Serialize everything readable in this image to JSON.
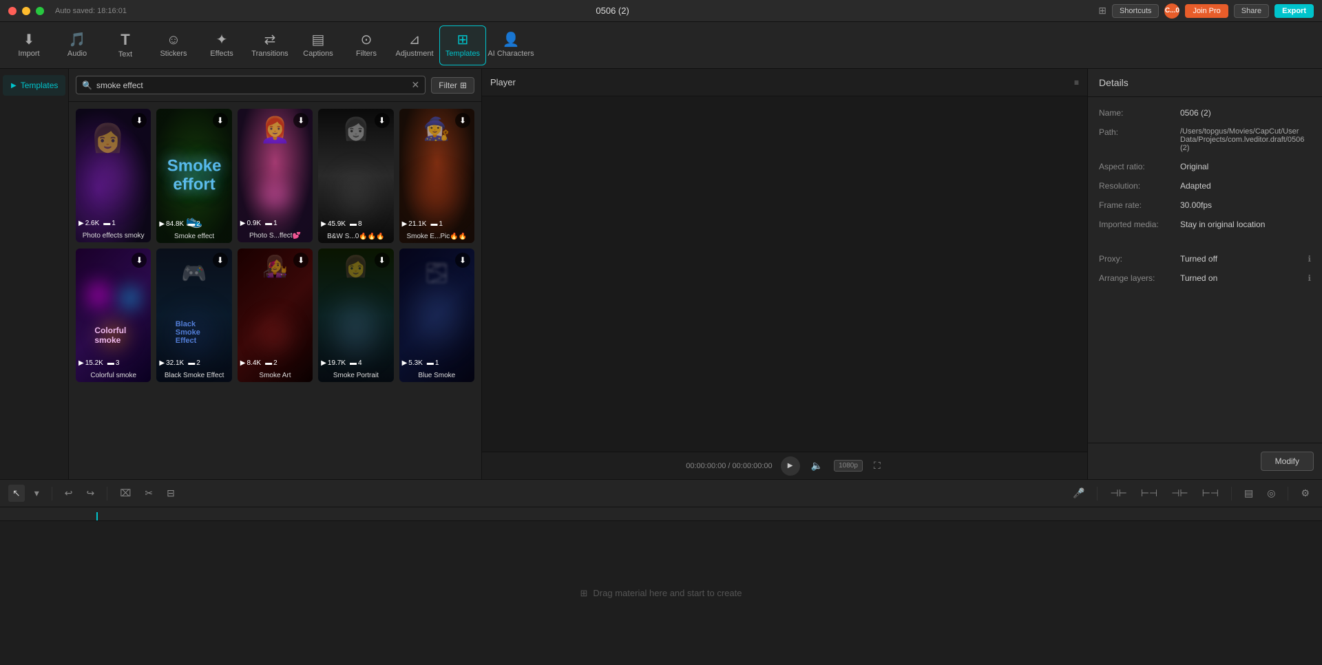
{
  "titleBar": {
    "windowTitle": "0506 (2)",
    "autoSavedLabel": "Auto saved: 18:16:01",
    "shortcuts": "Shortcuts",
    "userLabel": "C...0",
    "joinPro": "Join Pro",
    "share": "Share",
    "export": "Export"
  },
  "toolbar": {
    "items": [
      {
        "id": "import",
        "label": "Import",
        "icon": "⬇"
      },
      {
        "id": "audio",
        "label": "Audio",
        "icon": "♪"
      },
      {
        "id": "text",
        "label": "Text",
        "icon": "T"
      },
      {
        "id": "stickers",
        "label": "Stickers",
        "icon": "☺"
      },
      {
        "id": "effects",
        "label": "Effects",
        "icon": "✦"
      },
      {
        "id": "transitions",
        "label": "Transitions",
        "icon": "⇄"
      },
      {
        "id": "captions",
        "label": "Captions",
        "icon": "▤"
      },
      {
        "id": "filters",
        "label": "Filters",
        "icon": "⊙"
      },
      {
        "id": "adjustment",
        "label": "Adjustment",
        "icon": "⊿"
      },
      {
        "id": "templates",
        "label": "Templates",
        "icon": "⊞",
        "active": true
      },
      {
        "id": "ai-characters",
        "label": "AI Characters",
        "icon": "👤"
      }
    ]
  },
  "sidebar": {
    "items": [
      {
        "id": "templates",
        "label": "Templates",
        "active": true
      }
    ]
  },
  "search": {
    "placeholder": "smoke effect",
    "value": "smoke effect",
    "filterLabel": "Filter"
  },
  "templates": {
    "cards": [
      {
        "id": 1,
        "label": "Photo effects smoky",
        "stats": "2.6K",
        "clips": 1,
        "type": "card-1"
      },
      {
        "id": 2,
        "label": "Smoke effect",
        "stats": "84.8K",
        "clips": 2,
        "type": "card-2"
      },
      {
        "id": 3,
        "label": "Photo S...ffect💕",
        "stats": "0.9K",
        "clips": 1,
        "type": "card-3"
      },
      {
        "id": 4,
        "label": "B&W S...0🔥🔥🔥",
        "stats": "45.9K",
        "clips": 8,
        "type": "card-4"
      },
      {
        "id": 5,
        "label": "Smoke E...Pic🔥🔥",
        "stats": "21.1K",
        "clips": 1,
        "type": "card-5"
      },
      {
        "id": 6,
        "label": "Colorful smoke",
        "stats": "15.2K",
        "clips": 3,
        "type": "card-6"
      },
      {
        "id": 7,
        "label": "Black Smoke Effect",
        "stats": "32.1K",
        "clips": 2,
        "type": "card-7"
      },
      {
        "id": 8,
        "label": "Smoke Art",
        "stats": "8.4K",
        "clips": 2,
        "type": "card-8"
      },
      {
        "id": 9,
        "label": "Smoke Portrait",
        "stats": "19.7K",
        "clips": 4,
        "type": "card-9"
      },
      {
        "id": 10,
        "label": "Blue Smoke",
        "stats": "5.3K",
        "clips": 1,
        "type": "card-10"
      }
    ]
  },
  "player": {
    "title": "Player",
    "time": "00:00:00:00 / 00:00:00:00"
  },
  "details": {
    "title": "Details",
    "rows": [
      {
        "key": "Name:",
        "val": "0506 (2)"
      },
      {
        "key": "Path:",
        "val": "/Users/topgus/Movies/CapCut/User Data/Projects/com.lveditor.draft/0506 (2)"
      },
      {
        "key": "Aspect ratio:",
        "val": "Original"
      },
      {
        "key": "Resolution:",
        "val": "Adapted"
      },
      {
        "key": "Frame rate:",
        "val": "30.00fps"
      },
      {
        "key": "Imported media:",
        "val": "Stay in original location"
      },
      {
        "key": "Proxy:",
        "val": "Turned off",
        "hasInfo": true
      },
      {
        "key": "Arrange layers:",
        "val": "Turned on",
        "hasInfo": true
      }
    ],
    "modifyBtn": "Modify"
  },
  "timeline": {
    "dragHint": "Drag material here and start to create",
    "tools": [
      {
        "id": "pointer",
        "icon": "↖",
        "active": true
      },
      {
        "id": "dropdown",
        "icon": "▾"
      },
      {
        "id": "undo",
        "icon": "↩"
      },
      {
        "id": "redo",
        "icon": "↪"
      },
      {
        "id": "split",
        "icon": "⌧"
      },
      {
        "id": "divide",
        "icon": "⊹"
      },
      {
        "id": "delete",
        "icon": "⊟"
      },
      {
        "id": "mic",
        "icon": "🎤"
      },
      {
        "id": "t1",
        "icon": "⊣⊢"
      },
      {
        "id": "t2",
        "icon": "⊢⊣"
      },
      {
        "id": "t3",
        "icon": "⊣⊢"
      },
      {
        "id": "t4",
        "icon": "⊢⊣"
      },
      {
        "id": "caption",
        "icon": "▤"
      },
      {
        "id": "vol",
        "icon": "◎"
      }
    ]
  }
}
